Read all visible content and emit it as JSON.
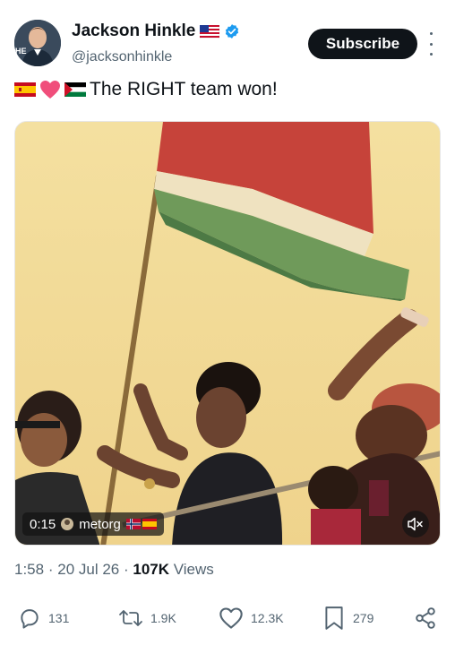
{
  "author": {
    "name": "Jackson Hinkle",
    "handle": "@jacksonhinkle",
    "name_emoji": "us-flag",
    "verified_icon": "verified-badge-icon",
    "avatar_mark": "HE"
  },
  "actions_top": {
    "subscribe_label": "Subscribe",
    "more_icon": "more-vertical-icon"
  },
  "tweet": {
    "emojis": [
      "spain-flag",
      "pink-heart",
      "palestine-flag"
    ],
    "text": "The RIGHT team won!"
  },
  "media": {
    "type": "video",
    "elapsed": "0:15",
    "overlay_user": "metorg",
    "overlay_emojis": [
      "norway-flag",
      "spain-flag"
    ],
    "mute_icon": "muted-speaker-icon"
  },
  "meta": {
    "time": "1:58",
    "separator": "·",
    "date": "20 Jul 26",
    "views_count": "107K",
    "views_label": "Views"
  },
  "engagement": {
    "replies": "131",
    "reposts": "1.9K",
    "likes": "12.3K",
    "bookmarks": "279",
    "share_icon": "share-icon"
  },
  "colors": {
    "text_primary": "#0f1419",
    "text_secondary": "#536471",
    "verified_blue": "#1d9bf0",
    "subscribe_bg": "#0f1419",
    "video_sky": "#f3dc96"
  }
}
